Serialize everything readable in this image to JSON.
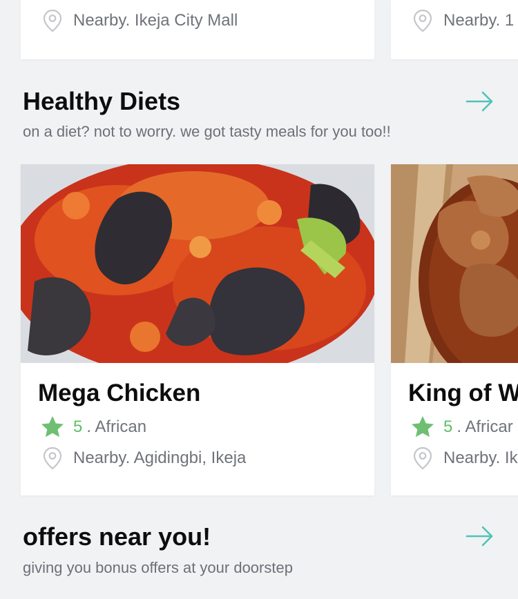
{
  "top_cards": [
    {
      "location": "Nearby. Ikeja City Mall"
    },
    {
      "location": "Nearby. 1"
    }
  ],
  "healthy": {
    "title": "Healthy Diets",
    "subtitle": "on a diet? not to worry. we got tasty meals for you too!!",
    "cards": [
      {
        "name": "Mega Chicken",
        "rating": "5",
        "cuisine": ". African",
        "location": "Nearby. Agidingbi, Ikeja"
      },
      {
        "name": "King of W",
        "rating": "5",
        "cuisine": ". Africar",
        "location": "Nearby. Ik"
      }
    ]
  },
  "offers": {
    "title": "offers near you!",
    "subtitle": "giving you bonus offers at your doorstep"
  },
  "colors": {
    "accent": "#4fc2b8",
    "star": "#6fbf73",
    "rating_text": "#5bbf63",
    "muted_text": "#6f7379"
  },
  "icons": {
    "location": "map-pin-icon",
    "rating": "star-icon",
    "see_more": "arrow-right-icon"
  }
}
